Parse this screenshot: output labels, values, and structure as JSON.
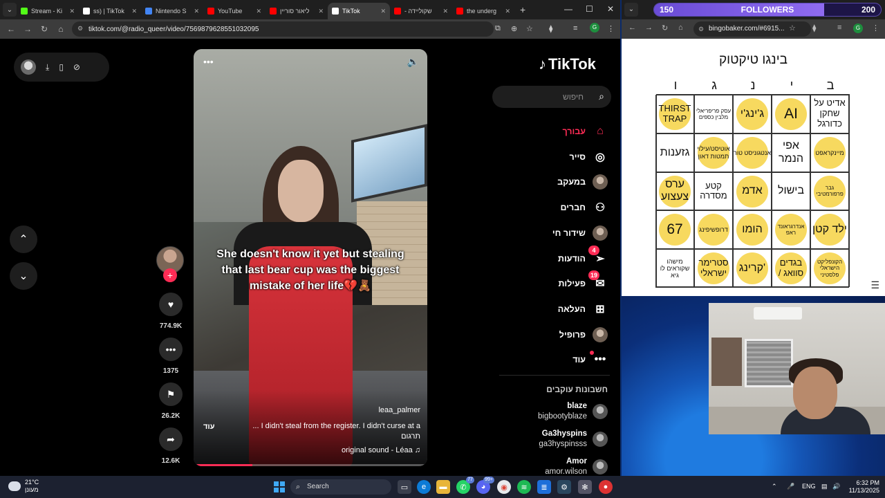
{
  "browser_left": {
    "tab_menu_icon": "chevron-down",
    "tabs": [
      {
        "label": "Stream - Ki",
        "color": "#53fc18"
      },
      {
        "label": "ss) | TikTok",
        "color": "#ffffff"
      },
      {
        "label": "Nintendo S",
        "color": "#4285f4"
      },
      {
        "label": "YouTube",
        "color": "#ff0000"
      },
      {
        "label": "ליאור סוריין",
        "color": "#ff0000"
      },
      {
        "label": "TikTok",
        "color": "#ffffff"
      },
      {
        "label": "- שקוליידה",
        "color": "#ff0000"
      },
      {
        "label": "the underg",
        "color": "#ff0000"
      }
    ],
    "url": "tiktok.com/@radio_queer/video/7569879628551032095"
  },
  "tiktok": {
    "logo": "TikTok",
    "search_placeholder": "חיפוש",
    "nav": [
      {
        "label": "עבורך",
        "icon": "home-icon"
      },
      {
        "label": "סייר",
        "icon": "compass-icon"
      },
      {
        "label": "במעקב",
        "icon": "following-icon"
      },
      {
        "label": "חברים",
        "icon": "friends-icon"
      },
      {
        "label": "שידור חי",
        "icon": "live-icon"
      },
      {
        "label": "הודעות",
        "icon": "messages-icon",
        "badge": "4"
      },
      {
        "label": "פעילות",
        "icon": "activity-icon",
        "badge": "19"
      },
      {
        "label": "העלאה",
        "icon": "upload-icon"
      },
      {
        "label": "פרופיל",
        "icon": "profile-icon"
      },
      {
        "label": "עוד",
        "icon": "more-icon"
      }
    ],
    "following_title": "חשבונות עוקבים",
    "following": [
      {
        "name": "blaze",
        "handle": "bigbootyblaze"
      },
      {
        "name": "Ga3hyspins",
        "handle": "ga3hyspinsss"
      },
      {
        "name": "Amor",
        "handle": "amor.wilson"
      }
    ],
    "video": {
      "caption": "She doesn't know it yet but stealing that last bear cup was the biggest mistake of her life💔🧸",
      "username": "leaa_palmer",
      "description": "... I didn't steal from the register. I didn't curse at a",
      "translate": "תרגום",
      "more": "עוד",
      "sound": "original sound - Léaa ♫",
      "progress": 0.25
    },
    "actions": {
      "likes": "774.9K",
      "comments": "1375",
      "saves": "26.2K",
      "shares": "12.6K"
    }
  },
  "followers_goal": {
    "current": "150",
    "label": "FOLLOWERS",
    "goal": "200",
    "fraction": 0.75
  },
  "browser_right": {
    "url": "bingobaker.com/#6915...",
    "bingo_title": "בינגו טיקטוק",
    "bingo_headers": [
      "ב",
      "י",
      "נ",
      "ג",
      "ו"
    ],
    "bingo_cells": [
      {
        "text": "אדיט על שחקן כדורגל",
        "marked": false,
        "size": "m"
      },
      {
        "text": "AI",
        "marked": true,
        "size": "xl"
      },
      {
        "text": "ג'ינג'י",
        "marked": true,
        "size": "l"
      },
      {
        "text": "עסק פריפריאלי מלבין כספים",
        "marked": false,
        "size": "xs"
      },
      {
        "text": "THIRST TRAP",
        "marked": true,
        "size": "m"
      },
      {
        "text": "מיינקראפט",
        "marked": true,
        "size": "s"
      },
      {
        "text": "אפי הנמר",
        "marked": false,
        "size": "l"
      },
      {
        "text": "אנטגוניסט טור",
        "marked": true,
        "size": "s"
      },
      {
        "text": "אוטיסט/עילוי תמטות דאון",
        "marked": true,
        "size": "s"
      },
      {
        "text": "גזענות",
        "marked": false,
        "size": "l"
      },
      {
        "text": "גבר פרפורמטיבי",
        "marked": true,
        "size": "xs"
      },
      {
        "text": "בישול",
        "marked": false,
        "size": "l"
      },
      {
        "text": "אדמ",
        "marked": true,
        "size": "l"
      },
      {
        "text": "קטע מסדרה",
        "marked": false,
        "size": "m"
      },
      {
        "text": "ערס צעצוע",
        "marked": true,
        "size": "l"
      },
      {
        "text": "ילד קטן",
        "marked": true,
        "size": "l"
      },
      {
        "text": "אנדרגראונד ראפ",
        "marked": true,
        "size": "xs"
      },
      {
        "text": "הומו",
        "marked": true,
        "size": "l"
      },
      {
        "text": "דרופשיפינג",
        "marked": true,
        "size": "s"
      },
      {
        "text": "67",
        "marked": true,
        "size": "xl"
      },
      {
        "text": "הקונפליקט הישראלי פלסטיני",
        "marked": true,
        "size": "xs"
      },
      {
        "text": "בגדים סוואג /",
        "marked": true,
        "size": "m"
      },
      {
        "text": "'קרינג",
        "marked": true,
        "size": "l"
      },
      {
        "text": "סטרימר ישראלי",
        "marked": true,
        "size": "m"
      },
      {
        "text": "מישהו שקוראים לו גיא",
        "marked": false,
        "size": "s"
      }
    ]
  },
  "taskbar": {
    "weather_temp": "21°C",
    "weather_desc": "מעונן",
    "search_label": "Search",
    "badges": {
      "whatsapp": "77",
      "discord": "99+"
    },
    "lang": "ENG",
    "time": "6:32 PM",
    "date": "11/13/2025"
  }
}
